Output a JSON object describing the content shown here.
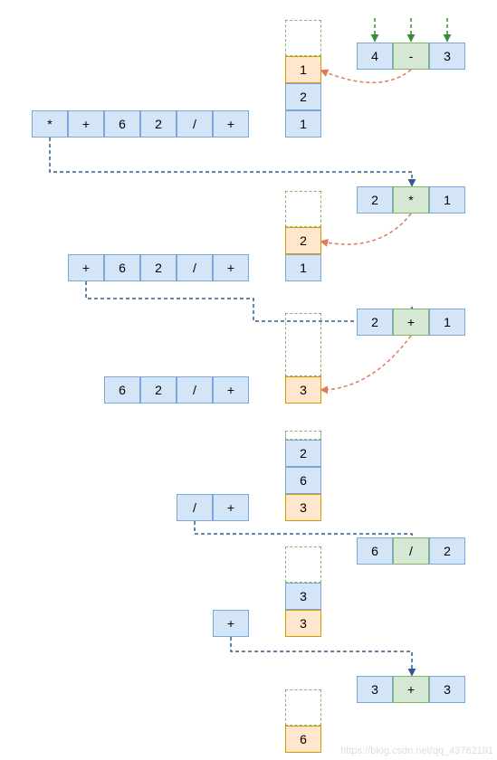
{
  "watermark": "https://blog.csdn.net/qq_43762191",
  "chart_data": [
    {
      "type": "diagram",
      "step": 1,
      "queue": [
        "*",
        "+",
        "6",
        "2",
        "/",
        "+"
      ],
      "stack_top_dash": true,
      "stack": [
        "1",
        "2",
        "1"
      ],
      "popped": [
        "4",
        "-",
        "3"
      ],
      "op_highlight": "-"
    },
    {
      "type": "diagram",
      "step": 2,
      "queue": [
        "+",
        "6",
        "2",
        "/",
        "+"
      ],
      "stack_top_dash": true,
      "stack": [
        "2",
        "1"
      ],
      "popped": [
        "2",
        "*",
        "1"
      ],
      "op_highlight": "*"
    },
    {
      "type": "diagram",
      "step": 3,
      "queue": [
        "6",
        "2",
        "/",
        "+"
      ],
      "stack_top_dash": true,
      "stack": [
        "3"
      ],
      "popped": [
        "2",
        "+",
        "1"
      ],
      "op_highlight": "+"
    },
    {
      "type": "diagram",
      "step": 4,
      "queue": [
        "/",
        "+"
      ],
      "stack_top_dash": true,
      "stack": [
        "2",
        "6",
        "3"
      ],
      "popped": null
    },
    {
      "type": "diagram",
      "step": 5,
      "queue": [
        "+"
      ],
      "stack_top_dash": true,
      "stack": [
        "3",
        "3"
      ],
      "popped": [
        "6",
        "/",
        "2"
      ],
      "op_highlight": "/"
    },
    {
      "type": "diagram",
      "step": 6,
      "queue": [],
      "stack_top_dash": true,
      "stack": [
        "6"
      ],
      "popped": [
        "3",
        "+",
        "3"
      ],
      "op_highlight": "+"
    }
  ],
  "steps": {
    "s1": {
      "queue": [
        "*",
        "+",
        "6",
        "2",
        "/",
        "+"
      ],
      "stack": [
        "1",
        "2",
        "1"
      ],
      "pop": [
        "4",
        "-",
        "3"
      ]
    },
    "s2": {
      "queue": [
        "+",
        "6",
        "2",
        "/",
        "+"
      ],
      "stack": [
        "2",
        "1"
      ],
      "pop": [
        "2",
        "*",
        "1"
      ]
    },
    "s3": {
      "queue": [
        "6",
        "2",
        "/",
        "+"
      ],
      "stack": [
        "3"
      ],
      "pop": [
        "2",
        "+",
        "1"
      ]
    },
    "s4": {
      "queue": [
        "/",
        "+"
      ],
      "stack": [
        "2",
        "6",
        "3"
      ]
    },
    "s5": {
      "queue": [
        "+"
      ],
      "stack": [
        "3",
        "3"
      ],
      "pop": [
        "6",
        "/",
        "2"
      ]
    },
    "s6": {
      "stack": [
        "6"
      ],
      "pop": [
        "3",
        "+",
        "3"
      ]
    }
  }
}
